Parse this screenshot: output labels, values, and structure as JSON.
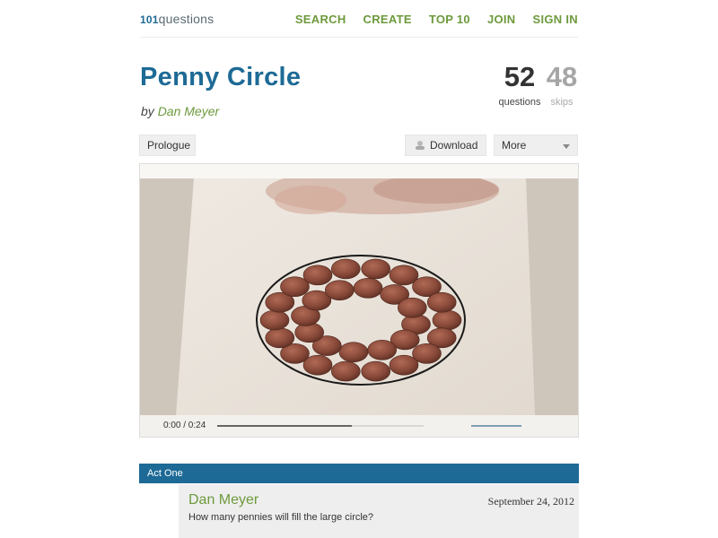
{
  "header": {
    "logo_number": "101",
    "logo_word": "questions",
    "nav": [
      "SEARCH",
      "CREATE",
      "TOP 10",
      "JOIN",
      "SIGN IN"
    ]
  },
  "page": {
    "title": "Penny Circle",
    "by_prefix": "by ",
    "author": "Dan Meyer"
  },
  "stats": {
    "questions_count": "52",
    "questions_label": "questions",
    "skips_count": "48",
    "skips_label": "skips"
  },
  "actions": {
    "prologue": "Prologue",
    "download": "Download",
    "more": "More"
  },
  "video": {
    "time": "0:00 / 0:24",
    "progress_fraction": 0.65
  },
  "act": {
    "label": "Act One"
  },
  "post": {
    "author": "Dan Meyer",
    "date": "September 24, 2012",
    "text": "How many pennies will fill the large circle?"
  },
  "colors": {
    "brand_blue": "#1d6a96",
    "accent_green": "#6d9a3c"
  }
}
